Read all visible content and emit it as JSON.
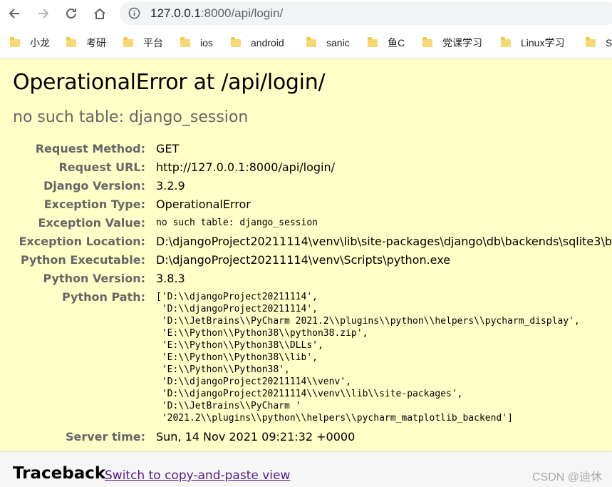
{
  "browser": {
    "url_host": "127.0.0.1",
    "url_path": ":8000/api/login/",
    "bookmarks": [
      "小龙",
      "考研",
      "平台",
      "ios",
      "android",
      "sanic",
      "鱼C",
      "党课学习",
      "Linux学习",
      "S"
    ]
  },
  "error": {
    "title": "OperationalError at /api/login/",
    "subtitle": "no such table: django_session",
    "meta": [
      {
        "label": "Request Method:",
        "value": "GET"
      },
      {
        "label": "Request URL:",
        "value": "http://127.0.0.1:8000/api/login/"
      },
      {
        "label": "Django Version:",
        "value": "3.2.9"
      },
      {
        "label": "Exception Type:",
        "value": "OperationalError"
      },
      {
        "label": "Exception Value:",
        "value": "no such table: django_session"
      },
      {
        "label": "Exception Location:",
        "value": "D:\\djangoProject20211114\\venv\\lib\\site-packages\\django\\db\\backends\\sqlite3\\b"
      },
      {
        "label": "Python Executable:",
        "value": "D:\\djangoProject20211114\\venv\\Scripts\\python.exe"
      },
      {
        "label": "Python Version:",
        "value": "3.8.3"
      },
      {
        "label": "Python Path:",
        "value": "['D:\\\\djangoProject20211114',\n 'D:\\\\djangoProject20211114',\n 'D:\\\\JetBrains\\\\PyCharm 2021.2\\\\plugins\\\\python\\\\helpers\\\\pycharm_display',\n 'E:\\\\Python\\\\Python38\\\\python38.zip',\n 'E:\\\\Python\\\\Python38\\\\DLLs',\n 'E:\\\\Python\\\\Python38\\\\lib',\n 'E:\\\\Python\\\\Python38',\n 'D:\\\\djangoProject20211114\\\\venv',\n 'D:\\\\djangoProject20211114\\\\venv\\\\lib\\\\site-packages',\n 'D:\\\\JetBrains\\\\PyCharm '\n '2021.2\\\\plugins\\\\python\\\\helpers\\\\pycharm_matplotlib_backend']"
      },
      {
        "label": "Server time:",
        "value": "Sun, 14 Nov 2021 09:21:32 +0000"
      }
    ]
  },
  "traceback": {
    "title": "Traceback",
    "link": "Switch to copy-and-paste view"
  },
  "watermark": "CSDN @迪休"
}
